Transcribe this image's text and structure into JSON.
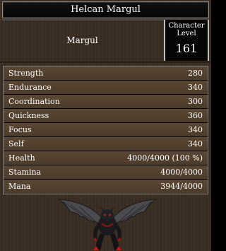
{
  "window": {
    "title": "Helcan Margul"
  },
  "character": {
    "name": "Margul",
    "level_label_line1": "Character",
    "level_label_line2": "Level",
    "level": "161"
  },
  "stats": [
    {
      "name": "Strength",
      "value": "280"
    },
    {
      "name": "Endurance",
      "value": "340"
    },
    {
      "name": "Coordination",
      "value": "300"
    },
    {
      "name": "Quickness",
      "value": "360"
    },
    {
      "name": "Focus",
      "value": "340"
    },
    {
      "name": "Self",
      "value": "340"
    },
    {
      "name": "Health",
      "value": "4000/4000 (100 %)"
    },
    {
      "name": "Stamina",
      "value": "4000/4000"
    },
    {
      "name": "Mana",
      "value": "3944/4000"
    }
  ],
  "portrait": {
    "icon": "winged-creature-portrait",
    "colors": {
      "body": "#1b1b1f",
      "wing": "#4a4a4f",
      "accent": "#c01a12"
    }
  }
}
